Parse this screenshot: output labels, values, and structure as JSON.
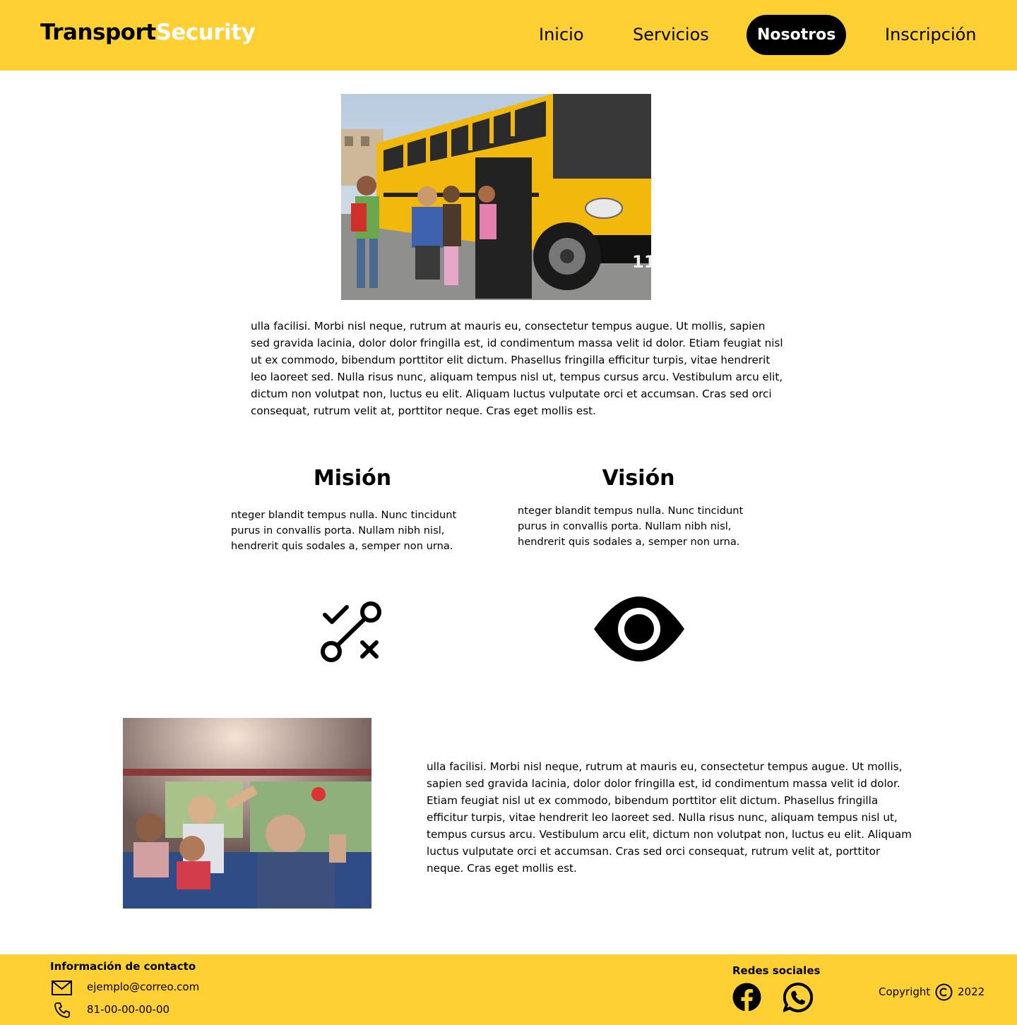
{
  "header": {
    "brand_part1": "Transport",
    "brand_part2": "Security",
    "nav": [
      "Inicio",
      "Servicios",
      "Nosotros",
      "Inscripción"
    ],
    "active_nav": "Nosotros"
  },
  "intro_text": "ulla facilisi. Morbi nisl neque, rutrum at mauris eu, consectetur tempus augue. Ut mollis, sapien sed gravida lacinia, dolor dolor fringilla est, id condimentum massa velit id dolor. Etiam feugiat nisl ut ex commodo, bibendum porttitor elit dictum. Phasellus fringilla efficitur turpis, vitae hendrerit leo laoreet sed. Nulla risus nunc, aliquam tempus nisl ut, tempus cursus arcu. Vestibulum arcu elit, dictum non volutpat non, luctus eu elit. Aliquam luctus vulputate orci et accumsan. Cras sed orci consequat, rutrum velit at, porttitor neque. Cras eget mollis est.",
  "mission": {
    "title": "Misión",
    "text": "nteger blandit tempus nulla. Nunc tincidunt purus in convallis porta. Nullam nibh nisl, hendrerit quis sodales a, semper non urna."
  },
  "vision": {
    "title": "Visión",
    "text": "nteger blandit tempus nulla. Nunc tincidunt purus in convallis porta. Nullam nibh nisl, hendrerit quis sodales a, semper non urna."
  },
  "bottom_text": "ulla facilisi. Morbi nisl neque, rutrum at mauris eu, consectetur tempus augue. Ut mollis, sapien sed gravida lacinia, dolor dolor fringilla est, id condimentum massa velit id dolor. Etiam feugiat nisl ut ex commodo, bibendum porttitor elit dictum. Phasellus fringilla efficitur turpis, vitae hendrerit leo laoreet sed. Nulla risus nunc, aliquam tempus nisl ut, tempus cursus arcu. Vestibulum arcu elit, dictum non volutpat non, luctus eu elit. Aliquam luctus vulputate orci et accumsan. Cras sed orci consequat, rutrum velit at, porttitor neque. Cras eget mollis est.",
  "footer": {
    "contact_title": "Información de contacto",
    "email": "ejemplo@correo.com",
    "phone": "81-00-00-00-00",
    "social_title": "Redes sociales",
    "copyright_label": "Copyright",
    "copyright_year": "2022"
  },
  "icons": {
    "mission": "route-check-x-icon",
    "vision": "eye-icon",
    "email": "envelope-icon",
    "phone": "phone-icon",
    "social": [
      "facebook-icon",
      "whatsapp-icon"
    ],
    "copyright": "copyright-icon"
  },
  "colors": {
    "brand_yellow": "#FFD033",
    "bus_yellow": "#F2B90C",
    "text": "#000000",
    "active_nav_bg": "#000000"
  }
}
